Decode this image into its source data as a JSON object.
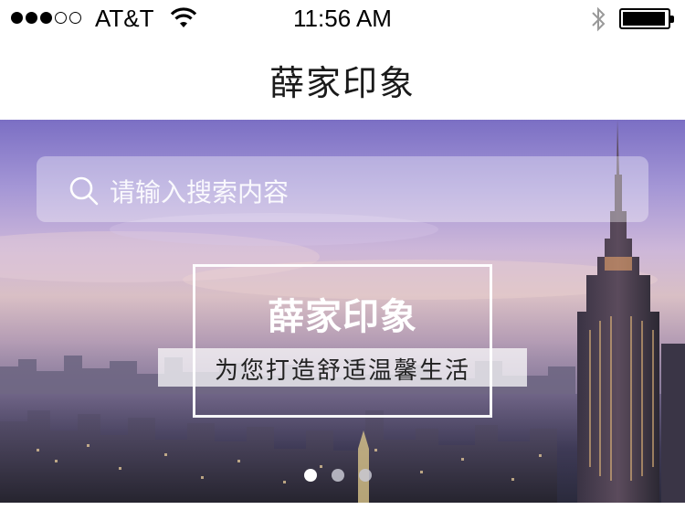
{
  "status_bar": {
    "carrier": "AT&T",
    "time": "11:56 AM",
    "signal_strength": 3,
    "signal_max": 5,
    "battery_level": 0.95,
    "icons": [
      "signal-dots-icon",
      "wifi-icon",
      "bluetooth-icon",
      "battery-icon"
    ]
  },
  "nav": {
    "title": "薛家印象"
  },
  "search": {
    "placeholder": "请输入搜索内容",
    "icon": "search-icon"
  },
  "banner": {
    "title": "薛家印象",
    "subtitle": "为您打造舒适温馨生活",
    "page_count": 3,
    "active_page": 1
  },
  "colors": {
    "sky_top": "#7b6fc4",
    "sky_mid": "#d9bfc5",
    "city_dark": "#2a2a3c",
    "text": "#1a1a1a"
  }
}
